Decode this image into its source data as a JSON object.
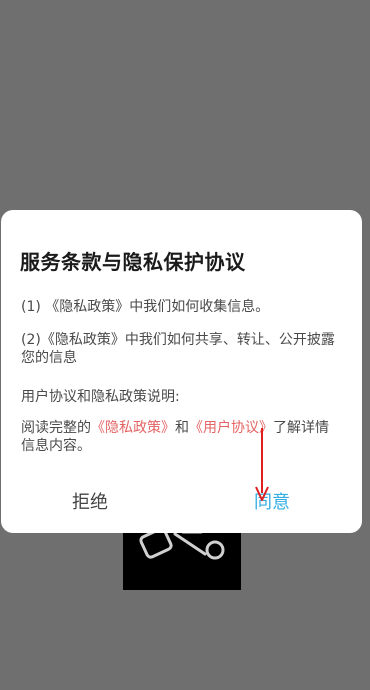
{
  "dialog": {
    "title": "服务条款与隐私保护协议",
    "item1": "(1) 《隐私政策》中我们如何收集信息。",
    "item2": "(2)《隐私政策》中我们如何共享、转让、公开披露您的信息",
    "section_heading": "用户协议和隐私政策说明:",
    "desc_prefix": "阅读完整的",
    "privacy_link": "《隐私政策》",
    "desc_and": "和",
    "user_link": "《用户协议》",
    "desc_suffix": "了解详情信息内容。",
    "reject_label": "拒绝",
    "agree_label": "同意"
  },
  "colors": {
    "link": "#e36464",
    "agree": "#33aee3",
    "annotation_arrow": "#e02020",
    "overlay": "#6f6f6f"
  },
  "icons": {
    "annotation": "red-arrow-pointing-down"
  }
}
